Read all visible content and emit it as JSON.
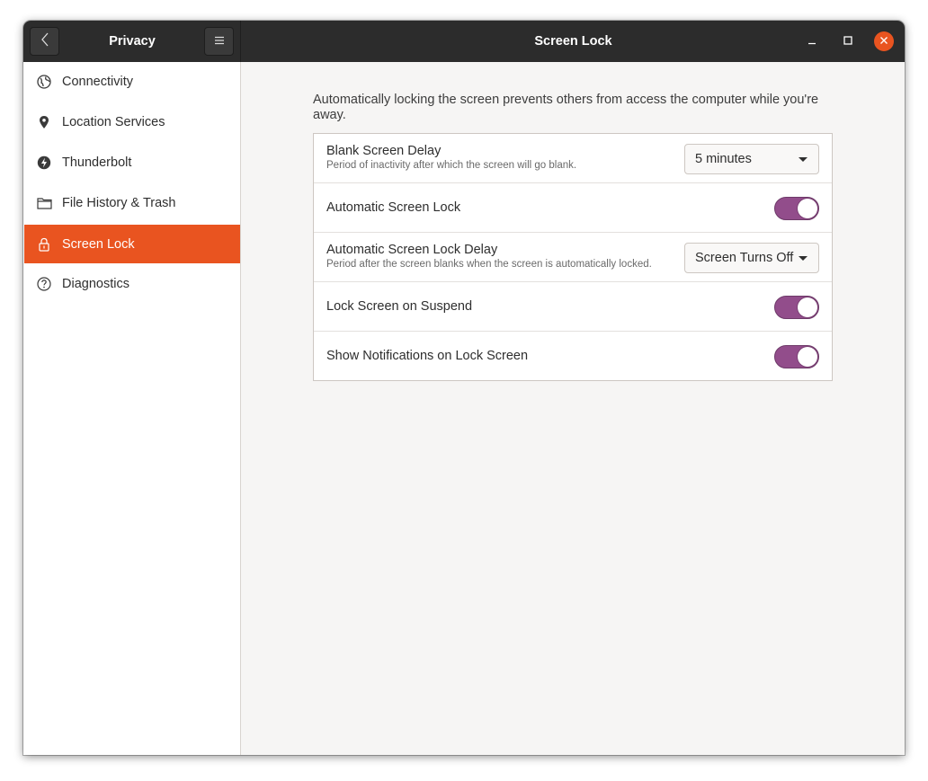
{
  "header": {
    "sidebar_title": "Privacy",
    "page_title": "Screen Lock"
  },
  "sidebar": {
    "items": [
      {
        "label": "Connectivity",
        "icon": "globe-icon"
      },
      {
        "label": "Location Services",
        "icon": "location-pin-icon"
      },
      {
        "label": "Thunderbolt",
        "icon": "thunderbolt-icon"
      },
      {
        "label": "File History & Trash",
        "icon": "folder-icon"
      },
      {
        "label": "Screen Lock",
        "icon": "lock-icon",
        "active": true
      },
      {
        "label": "Diagnostics",
        "icon": "help-circle-icon"
      }
    ]
  },
  "main": {
    "intro": "Automatically locking the screen prevents others from access the computer while you're away.",
    "rows": [
      {
        "title": "Blank Screen Delay",
        "subtitle": "Period of inactivity after which the screen will go blank.",
        "control": "dropdown",
        "value": "5 minutes"
      },
      {
        "title": "Automatic Screen Lock",
        "control": "toggle",
        "on": true
      },
      {
        "title": "Automatic Screen Lock Delay",
        "subtitle": "Period after the screen blanks when the screen is automatically locked.",
        "control": "dropdown",
        "value": "Screen Turns Off"
      },
      {
        "title": "Lock Screen on Suspend",
        "control": "toggle",
        "on": true
      },
      {
        "title": "Show Notifications on Lock Screen",
        "control": "toggle",
        "on": true
      }
    ]
  },
  "colors": {
    "accent": "#e95420",
    "toggle_on": "#924d8b",
    "headerbar": "#2c2c2c"
  }
}
